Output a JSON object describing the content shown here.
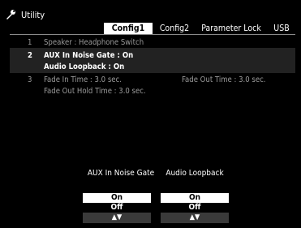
{
  "app": {
    "title": "Utility"
  },
  "tabs": [
    {
      "label": "Config1",
      "active": true
    },
    {
      "label": "Config2",
      "active": false
    },
    {
      "label": "Parameter Lock",
      "active": false
    },
    {
      "label": "USB",
      "active": false
    }
  ],
  "params": {
    "row1": {
      "num": "1",
      "label": "Speaker : Headphone Switch"
    },
    "row2a": {
      "num": "2",
      "label": "AUX In Noise Gate : On"
    },
    "row2b": {
      "label": "Audio Loopback : On"
    },
    "row3a": {
      "num": "3",
      "label": "Fade In Time :  3.0 sec.",
      "label2": "Fade Out Time :  3.0 sec."
    },
    "row3b": {
      "label": "Fade Out Hold Time :  3.0 sec."
    }
  },
  "selectors": {
    "aux": {
      "header": "AUX In Noise Gate",
      "options": [
        "On",
        "Off"
      ],
      "selected": "On",
      "arrows": "▲▼"
    },
    "loop": {
      "header": "Audio Loopback",
      "options": [
        "On",
        "Off"
      ],
      "selected": "On",
      "arrows": "▲▼"
    }
  },
  "colors": {
    "selected_text": "#ffffff",
    "dim_text": "#9a9a9a",
    "active_tab_bg": "#ffffff"
  }
}
